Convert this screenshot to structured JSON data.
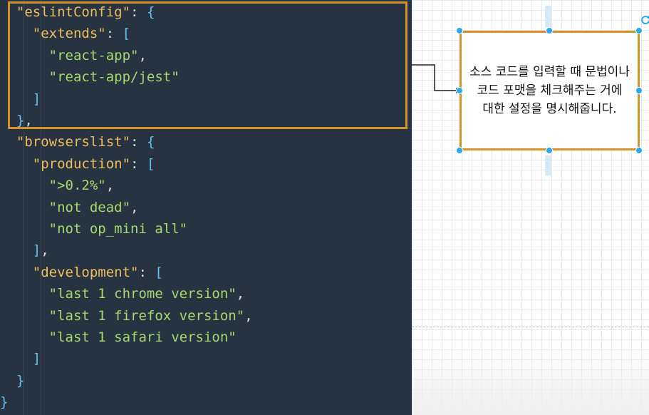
{
  "editor": {
    "lines": [
      {
        "indent": "  ",
        "key": "\"eslintConfig\"",
        "str": "",
        "punct": ": ",
        "brk": "{",
        "tail": ""
      },
      {
        "indent": "    ",
        "key": "\"extends\"",
        "str": "",
        "punct": ": ",
        "brk": "[",
        "tail": ""
      },
      {
        "indent": "      ",
        "key": "",
        "str": "\"react-app\"",
        "punct": ",",
        "brk": "",
        "tail": ""
      },
      {
        "indent": "      ",
        "key": "",
        "str": "\"react-app/jest\"",
        "punct": "",
        "brk": "",
        "tail": ""
      },
      {
        "indent": "    ",
        "key": "",
        "str": "",
        "punct": "",
        "brk": "]",
        "tail": ""
      },
      {
        "indent": "  ",
        "key": "",
        "str": "",
        "punct": "",
        "brk": "}",
        "tail": ","
      },
      {
        "indent": "  ",
        "key": "\"browserslist\"",
        "str": "",
        "punct": ": ",
        "brk": "{",
        "tail": ""
      },
      {
        "indent": "    ",
        "key": "\"production\"",
        "str": "",
        "punct": ": ",
        "brk": "[",
        "tail": ""
      },
      {
        "indent": "      ",
        "key": "",
        "str": "\">0.2%\"",
        "punct": ",",
        "brk": "",
        "tail": ""
      },
      {
        "indent": "      ",
        "key": "",
        "str": "\"not dead\"",
        "punct": ",",
        "brk": "",
        "tail": ""
      },
      {
        "indent": "      ",
        "key": "",
        "str": "\"not op_mini all\"",
        "punct": "",
        "brk": "",
        "tail": ""
      },
      {
        "indent": "    ",
        "key": "",
        "str": "",
        "punct": "",
        "brk": "]",
        "tail": ","
      },
      {
        "indent": "    ",
        "key": "\"development\"",
        "str": "",
        "punct": ": ",
        "brk": "[",
        "tail": ""
      },
      {
        "indent": "      ",
        "key": "",
        "str": "\"last 1 chrome version\"",
        "punct": ",",
        "brk": "",
        "tail": ""
      },
      {
        "indent": "      ",
        "key": "",
        "str": "\"last 1 firefox version\"",
        "punct": ",",
        "brk": "",
        "tail": ""
      },
      {
        "indent": "      ",
        "key": "",
        "str": "\"last 1 safari version\"",
        "punct": "",
        "brk": "",
        "tail": ""
      },
      {
        "indent": "    ",
        "key": "",
        "str": "",
        "punct": "",
        "brk": "]",
        "tail": ""
      },
      {
        "indent": "  ",
        "key": "",
        "str": "",
        "punct": "",
        "brk": "}",
        "tail": ""
      },
      {
        "indent": "",
        "key": "",
        "str": "",
        "punct": "",
        "brk": "}",
        "tail": ""
      }
    ]
  },
  "diagram": {
    "note_text": "소스 코드를 입력할 때 문법이나 코드 포맷을 체크해주는 거에 대한 설정을 명시해줍니다."
  },
  "colors": {
    "editor_bg": "#273341",
    "highlight": "#d4942b",
    "handle": "#29a8f0",
    "key": "#eebd5d",
    "string": "#a6d86e",
    "bracket": "#5ec4e8"
  },
  "icons": [
    "connector-arrow-icon",
    "rotate-handle-icon",
    "selection-handle-icon"
  ]
}
